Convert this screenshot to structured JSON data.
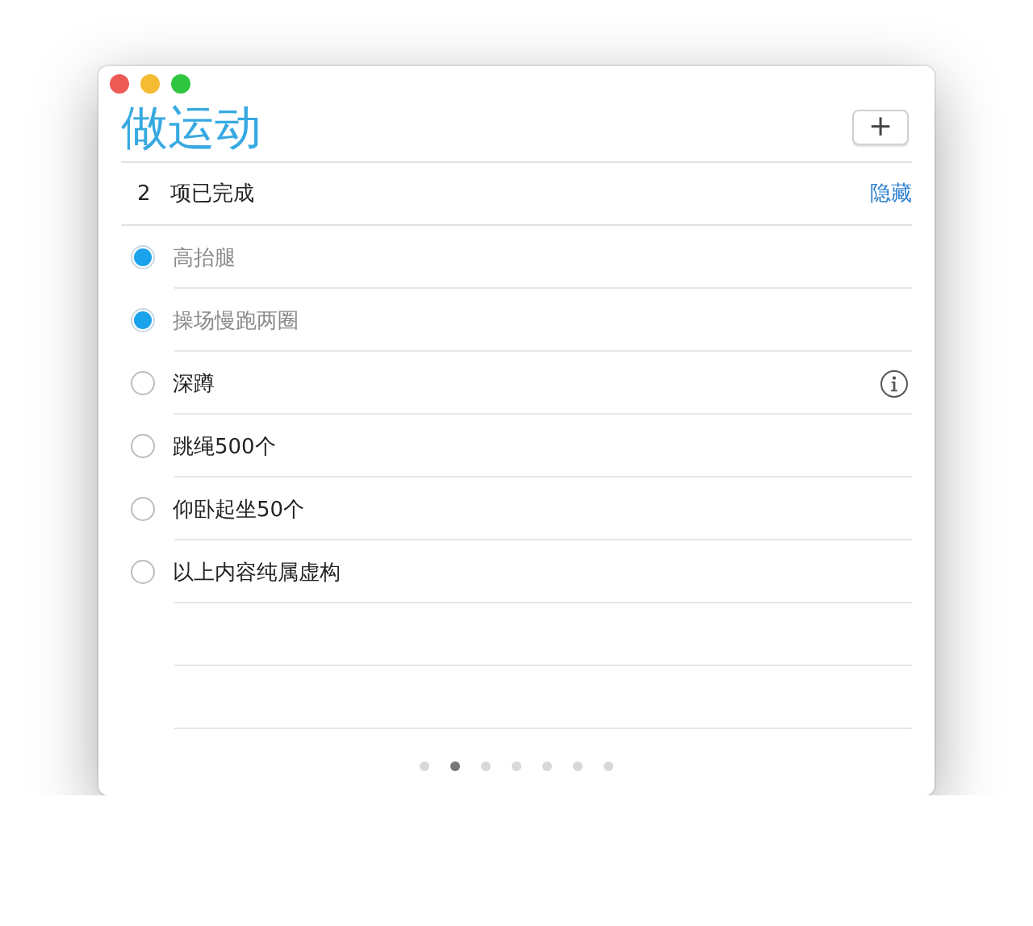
{
  "window": {
    "title": "做运动"
  },
  "add_button": {
    "label": "+"
  },
  "completed_bar": {
    "count": "2",
    "label": "项已完成",
    "action": "隐藏"
  },
  "items": [
    {
      "text": "高抬腿",
      "checked": true,
      "info": false
    },
    {
      "text": "操场慢跑两圈",
      "checked": true,
      "info": false
    },
    {
      "text": "深蹲",
      "checked": false,
      "info": true
    },
    {
      "text": "跳绳500个",
      "checked": false,
      "info": false
    },
    {
      "text": "仰卧起坐50个",
      "checked": false,
      "info": false
    },
    {
      "text": "以上内容纯属虚构",
      "checked": false,
      "info": false
    }
  ],
  "pages": [
    {
      "selected": false
    },
    {
      "selected": true
    },
    {
      "selected": false
    },
    {
      "selected": false
    },
    {
      "selected": false
    },
    {
      "selected": false
    },
    {
      "selected": false
    }
  ]
}
